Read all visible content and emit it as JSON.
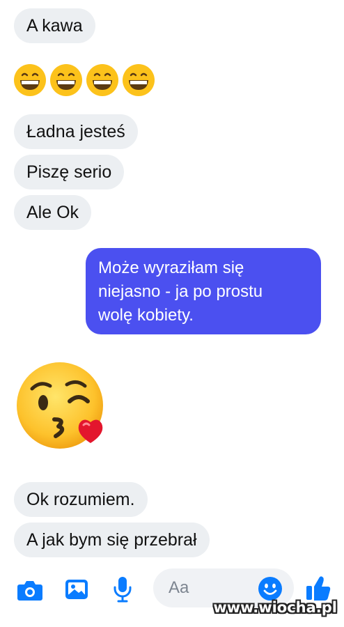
{
  "messages": {
    "m1": "A kawa",
    "m3": "Ładna jesteś",
    "m4": "Piszę serio",
    "m5": "Ale Ok",
    "outgoing_lines": [
      "Może wyraziłam się",
      "niejasno -  ja po prostu",
      "wolę kobiety."
    ],
    "m8": "Ok rozumiem.",
    "m9": "A jak bym się przebrał"
  },
  "emoji": {
    "row": [
      "grinning-face",
      "grinning-face",
      "grinning-face",
      "grinning-face"
    ],
    "reaction": "face-blowing-a-kiss"
  },
  "composer": {
    "placeholder": "Aa",
    "icons": [
      "camera-icon",
      "gallery-icon",
      "microphone-icon",
      "emoji-icon",
      "thumbs-up-icon"
    ],
    "accent": "#0a7cff"
  },
  "colors": {
    "incoming_bg": "#eceff2",
    "outgoing_bg": "#4b50f0"
  },
  "watermark": "www.wiocha.pl"
}
